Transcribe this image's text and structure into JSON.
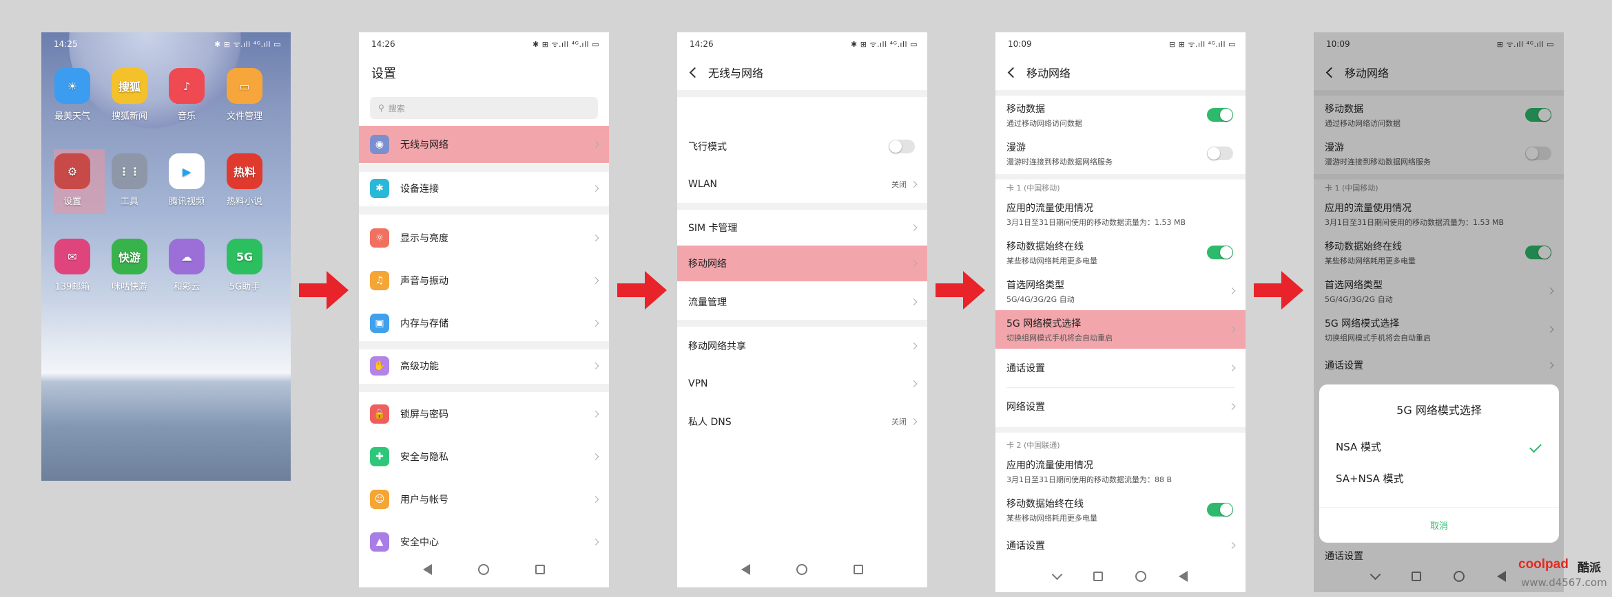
{
  "screen1": {
    "status_time": "14:25",
    "status_right": "✱ ⊞ ᯤ.ıll ⁴ᴳ.ıll ▭",
    "apps": [
      {
        "label": "最美天气",
        "color": "#3c9df0",
        "glyph": "☀"
      },
      {
        "label": "搜狐新闻",
        "color": "#f4c12a",
        "glyph": "搜狐"
      },
      {
        "label": "音乐",
        "color": "#ef4a52",
        "glyph": "♪"
      },
      {
        "label": "文件管理",
        "color": "#f6a63a",
        "glyph": "▭"
      },
      {
        "label": "设置",
        "color": "#c74a48",
        "glyph": "⚙"
      },
      {
        "label": "工具",
        "color": "#8e97a8",
        "glyph": "⋮⋮"
      },
      {
        "label": "腾讯视频",
        "color": "#ffffff",
        "glyph": "▶"
      },
      {
        "label": "热料小说",
        "color": "#e03a2e",
        "glyph": "热料"
      },
      {
        "label": "139邮箱",
        "color": "#e0447c",
        "glyph": "✉"
      },
      {
        "label": "咪咕快游",
        "color": "#38b24a",
        "glyph": "快游"
      },
      {
        "label": "和彩云",
        "color": "#9b6ed8",
        "glyph": "☁"
      },
      {
        "label": "5G助手",
        "color": "#2cbf5f",
        "glyph": "5G"
      }
    ]
  },
  "screen2": {
    "status_time": "14:26",
    "status_right": "✱ ⊞ ᯤ.ıll ⁴ᴳ.ıll ▭",
    "title": "设置",
    "search_placeholder": "搜索",
    "items": [
      {
        "label": "无线与网络",
        "color": "#7b8fce",
        "glyph": "◉"
      },
      {
        "label": "设备连接",
        "color": "#28b8d8",
        "glyph": "✱"
      },
      {
        "label": "显示与亮度",
        "color": "#f1705f",
        "glyph": "☼"
      },
      {
        "label": "声音与振动",
        "color": "#f5a534",
        "glyph": "♫"
      },
      {
        "label": "内存与存储",
        "color": "#3fa0ec",
        "glyph": "▣"
      },
      {
        "label": "高级功能",
        "color": "#b383e8",
        "glyph": "✋"
      },
      {
        "label": "锁屏与密码",
        "color": "#ef5d5d",
        "glyph": "🔒"
      },
      {
        "label": "安全与隐私",
        "color": "#2ec77a",
        "glyph": "✚"
      },
      {
        "label": "用户与帐号",
        "color": "#f5a534",
        "glyph": "☺"
      },
      {
        "label": "安全中心",
        "color": "#a97de6",
        "glyph": "▲"
      }
    ]
  },
  "screen3": {
    "status_time": "14:26",
    "status_right": "✱ ⊞ ᯤ.ıll ⁴ᴳ.ıll ▭",
    "title": "无线与网络",
    "items": [
      {
        "label": "飞行模式"
      },
      {
        "label": "WLAN",
        "value": "关闭"
      },
      {
        "label": "SIM 卡管理"
      },
      {
        "label": "移动网络"
      },
      {
        "label": "流量管理"
      },
      {
        "label": "移动网络共享"
      },
      {
        "label": "VPN"
      },
      {
        "label": "私人 DNS",
        "value": "关闭"
      }
    ]
  },
  "screen4": {
    "status_time": "10:09",
    "status_right": "⊟ ⊞ ᯤ.ıll ⁴ᴳ.ıll ▭",
    "title": "移动网络",
    "mobile_data": {
      "label": "移动数据",
      "sub": "通过移动网络访问数据"
    },
    "roaming": {
      "label": "漫游",
      "sub": "漫游时连接到移动数据网络服务"
    },
    "card1": "卡 1 (中国移动)",
    "app_usage1": {
      "label": "应用的流量使用情况",
      "sub": "3月1日至31日期间使用的移动数据流量为：1.53 MB"
    },
    "always_on1": {
      "label": "移动数据始终在线",
      "sub": "某些移动网络耗用更多电量"
    },
    "pref_net": {
      "label": "首选网络类型",
      "sub": "5G/4G/3G/2G 自动"
    },
    "mode5g": {
      "label": "5G 网络模式选择",
      "sub": "切换组网模式手机将会自动重启"
    },
    "call": {
      "label": "通话设置"
    },
    "net": {
      "label": "网络设置"
    },
    "card2": "卡 2 (中国联通)",
    "app_usage2": {
      "label": "应用的流量使用情况",
      "sub": "3月1日至31日期间使用的移动数据流量为：88 B"
    },
    "always_on2": {
      "label": "移动数据始终在线",
      "sub": "某些移动网络耗用更多电量"
    },
    "call2": {
      "label": "通话设置"
    }
  },
  "screen5": {
    "status_time": "10:09",
    "status_right": "⊞ ᯤ.ıll ⁴ᴳ.ıll ▭",
    "title": "移动网络",
    "mobile_data": {
      "label": "移动数据",
      "sub": "通过移动网络访问数据"
    },
    "roaming": {
      "label": "漫游",
      "sub": "漫游时连接到移动数据网络服务"
    },
    "card1": "卡 1 (中国移动)",
    "app_usage1": {
      "label": "应用的流量使用情况",
      "sub": "3月1日至31日期间使用的移动数据流量为：1.53 MB"
    },
    "always_on1": {
      "label": "移动数据始终在线",
      "sub": "某些移动网络耗用更多电量"
    },
    "pref_net": {
      "label": "首选网络类型",
      "sub": "5G/4G/3G/2G 自动"
    },
    "mode5g": {
      "label": "5G 网络模式选择",
      "sub": "切换组网模式手机将会自动重启"
    },
    "call": {
      "label": "通话设置"
    },
    "call_bottom": {
      "label": "通话设置"
    },
    "dialog": {
      "title": "5G 网络模式选择",
      "option1": "NSA 模式",
      "option2": "SA+NSA 模式",
      "cancel": "取消"
    }
  },
  "colors": {
    "arrow": "#e8232a",
    "highlight": "#f2a6ab",
    "switch_on": "#2dba6c"
  },
  "watermark": {
    "brand": "coolpad",
    "brand_cn": "酷派",
    "url": "www.d4567.com"
  }
}
